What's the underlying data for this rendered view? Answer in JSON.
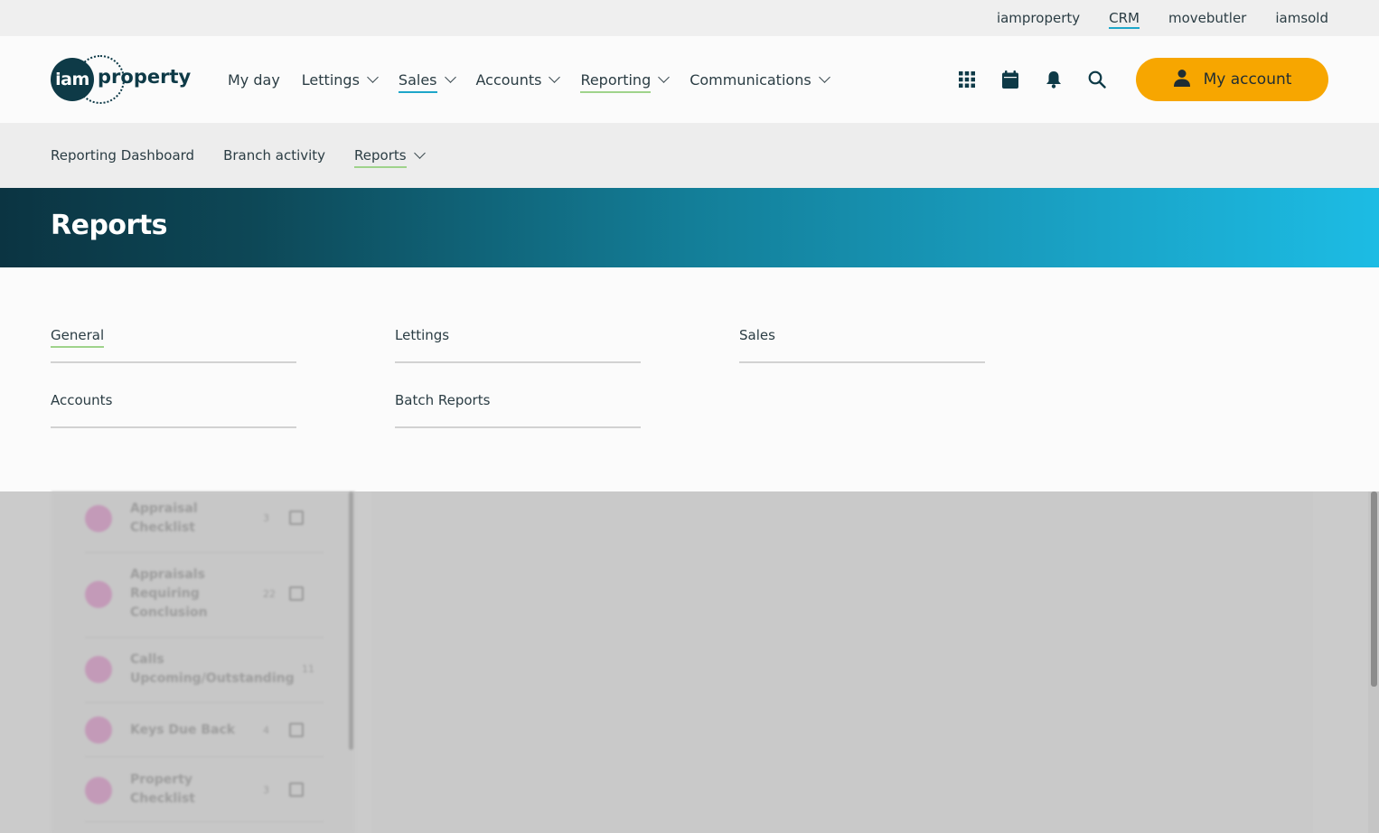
{
  "top_links": [
    {
      "label": "iamproperty",
      "active": false
    },
    {
      "label": "CRM",
      "active": true
    },
    {
      "label": "movebutler",
      "active": false
    },
    {
      "label": "iamsold",
      "active": false
    }
  ],
  "logo": {
    "mark": "iam",
    "word": "property"
  },
  "main_nav": [
    {
      "label": "My day",
      "dropdown": false,
      "underline": ""
    },
    {
      "label": "Lettings",
      "dropdown": true,
      "underline": ""
    },
    {
      "label": "Sales",
      "dropdown": true,
      "underline": "blue"
    },
    {
      "label": "Accounts",
      "dropdown": true,
      "underline": ""
    },
    {
      "label": "Reporting",
      "dropdown": true,
      "underline": "green"
    },
    {
      "label": "Communications",
      "dropdown": true,
      "underline": ""
    }
  ],
  "header_icons": [
    "apps-grid-icon",
    "calendar-icon",
    "bell-icon",
    "search-icon"
  ],
  "account_button": {
    "label": "My account",
    "icon": "user-icon",
    "color": "#f7a600"
  },
  "sub_nav": [
    {
      "label": "Reporting Dashboard",
      "dropdown": false,
      "active": false
    },
    {
      "label": "Branch activity",
      "dropdown": false,
      "active": false
    },
    {
      "label": "Reports",
      "dropdown": true,
      "active": true
    }
  ],
  "banner": {
    "title": "Reports"
  },
  "report_links": [
    {
      "label": "General",
      "active": true
    },
    {
      "label": "Lettings",
      "active": false
    },
    {
      "label": "Sales",
      "active": false
    },
    {
      "label": "Accounts",
      "active": false
    },
    {
      "label": "Batch Reports",
      "active": false
    }
  ],
  "background_list": [
    {
      "label": "Appraisal Checklist",
      "count": "3"
    },
    {
      "label": "Appraisals Requiring Conclusion",
      "count": "22"
    },
    {
      "label": "Calls Upcoming/Outstanding",
      "count": "11"
    },
    {
      "label": "Keys Due Back",
      "count": "4"
    },
    {
      "label": "Property Checklist",
      "count": "3"
    }
  ],
  "colors": {
    "accent_blue": "#1ea6c9",
    "accent_green": "#9fd38b",
    "brand_dark": "#0e3a47",
    "button_orange": "#f7a600"
  }
}
